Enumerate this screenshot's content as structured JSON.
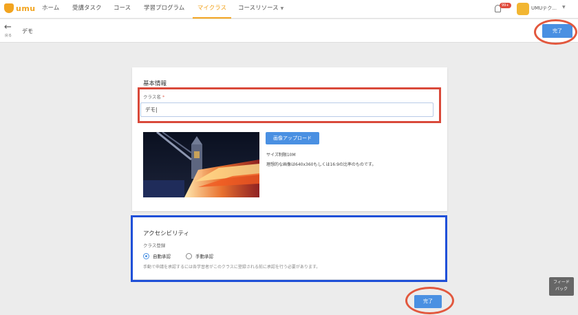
{
  "nav": {
    "logo": "umu",
    "items": [
      {
        "label": "ホーム"
      },
      {
        "label": "受講タスク"
      },
      {
        "label": "コース"
      },
      {
        "label": "学習プログラム"
      },
      {
        "label": "マイクラス",
        "active": true
      },
      {
        "label": "コースリソース"
      }
    ],
    "notification_badge": "99+",
    "user_name": "UMUテク..."
  },
  "subheader": {
    "back_label": "戻る",
    "title": "デモ",
    "done_label": "完了"
  },
  "basic_info": {
    "title": "基本情報",
    "class_name_label": "クラス名",
    "required_mark": "*",
    "class_name_value": "デモ|",
    "upload_button": "画像アップロード",
    "size_limit": "サイズ制限10M",
    "recommendation": "理想的な画像は640x360もしくは16:9の比率のものです。"
  },
  "accessibility": {
    "title": "アクセシビリティ",
    "enrollment_label": "クラス登録",
    "options": [
      {
        "label": "自動承認",
        "selected": true
      },
      {
        "label": "手動承認",
        "selected": false
      }
    ],
    "note": "手動で申請を承認するには各学習者がこのクラスに登録される前に承認を行う必要があります。"
  },
  "footer": {
    "done_label": "完了",
    "feedback_label": "フィード\nバック"
  },
  "colors": {
    "accent": "#f2a420",
    "primary_button": "#4a90e2",
    "highlight_red": "#d9493a",
    "highlight_blue": "#1e4fd8"
  }
}
